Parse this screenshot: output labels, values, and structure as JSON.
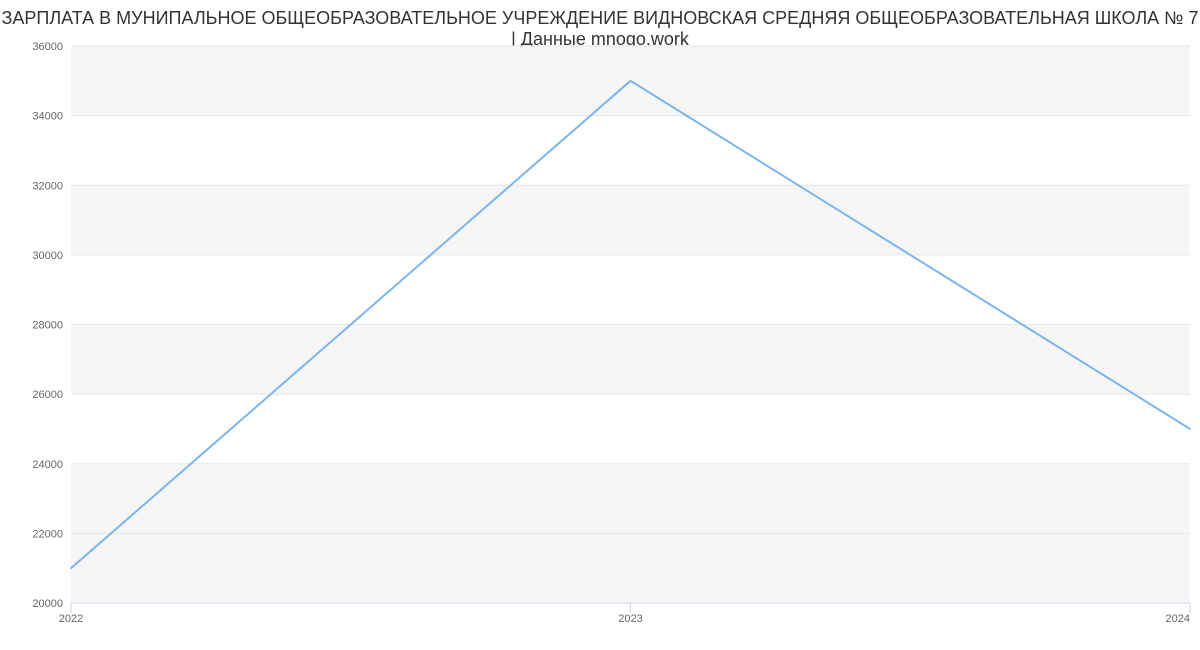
{
  "title": "ЗАРПЛАТА В МУНИПАЛЬНОЕ ОБЩЕОБРАЗОВАТЕЛЬНОЕ УЧРЕЖДЕНИЕ ВИДНОВСКАЯ СРЕДНЯЯ ОБЩЕОБРАЗОВАТЕЛЬНАЯ ШКОЛА № 7 | Данные mnogo.work",
  "chart_data": {
    "type": "line",
    "x": [
      "2022",
      "2023",
      "2024"
    ],
    "values": [
      21000,
      35000,
      25000
    ],
    "xlabel": "",
    "ylabel": "",
    "ylim": [
      20000,
      36000
    ],
    "yticks": [
      20000,
      22000,
      24000,
      26000,
      28000,
      30000,
      32000,
      34000,
      36000
    ],
    "xticks": [
      "2022",
      "2023",
      "2024"
    ],
    "grid": true,
    "legend": false,
    "line_color": "#7cb5ec"
  },
  "yticks": {
    "t0": "20000",
    "t1": "22000",
    "t2": "24000",
    "t3": "26000",
    "t4": "28000",
    "t5": "30000",
    "t6": "32000",
    "t7": "34000",
    "t8": "36000"
  },
  "xticks": {
    "x0": "2022",
    "x1": "2023",
    "x2": "2024"
  }
}
